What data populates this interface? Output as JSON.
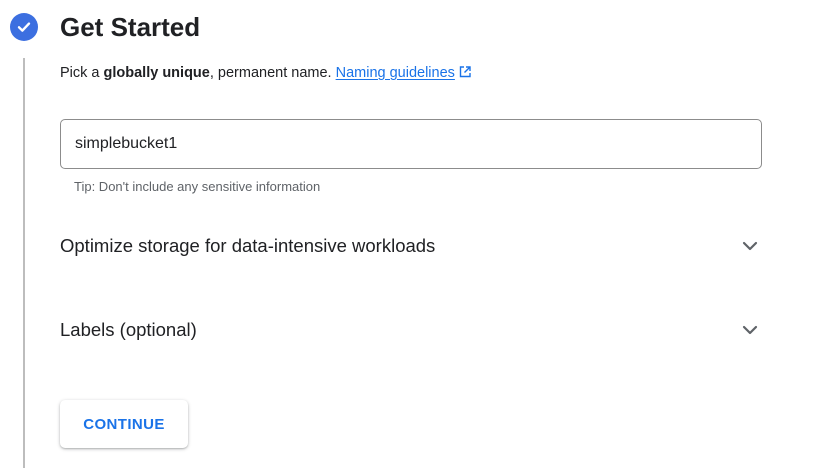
{
  "step": {
    "title": "Get Started",
    "status": "completed"
  },
  "description": {
    "prefix": "Pick a ",
    "emphasis": "globally unique",
    "suffix": ", permanent name. ",
    "link_label": "Naming guidelines"
  },
  "name_field": {
    "value": "simplebucket1",
    "hint": "Tip: Don't include any sensitive information"
  },
  "sections": [
    {
      "label": "Optimize storage for data-intensive workloads",
      "expanded": false
    },
    {
      "label": "Labels (optional)",
      "expanded": false
    }
  ],
  "actions": {
    "continue_label": "CONTINUE"
  },
  "icons": {
    "step_status": "check-circle-icon",
    "external_link": "open-in-new-icon",
    "expand": "chevron-down-icon"
  },
  "colors": {
    "accent": "#1a73e8",
    "step_check": "#3c6fe0",
    "text": "#202124",
    "hint": "#5f6368"
  }
}
